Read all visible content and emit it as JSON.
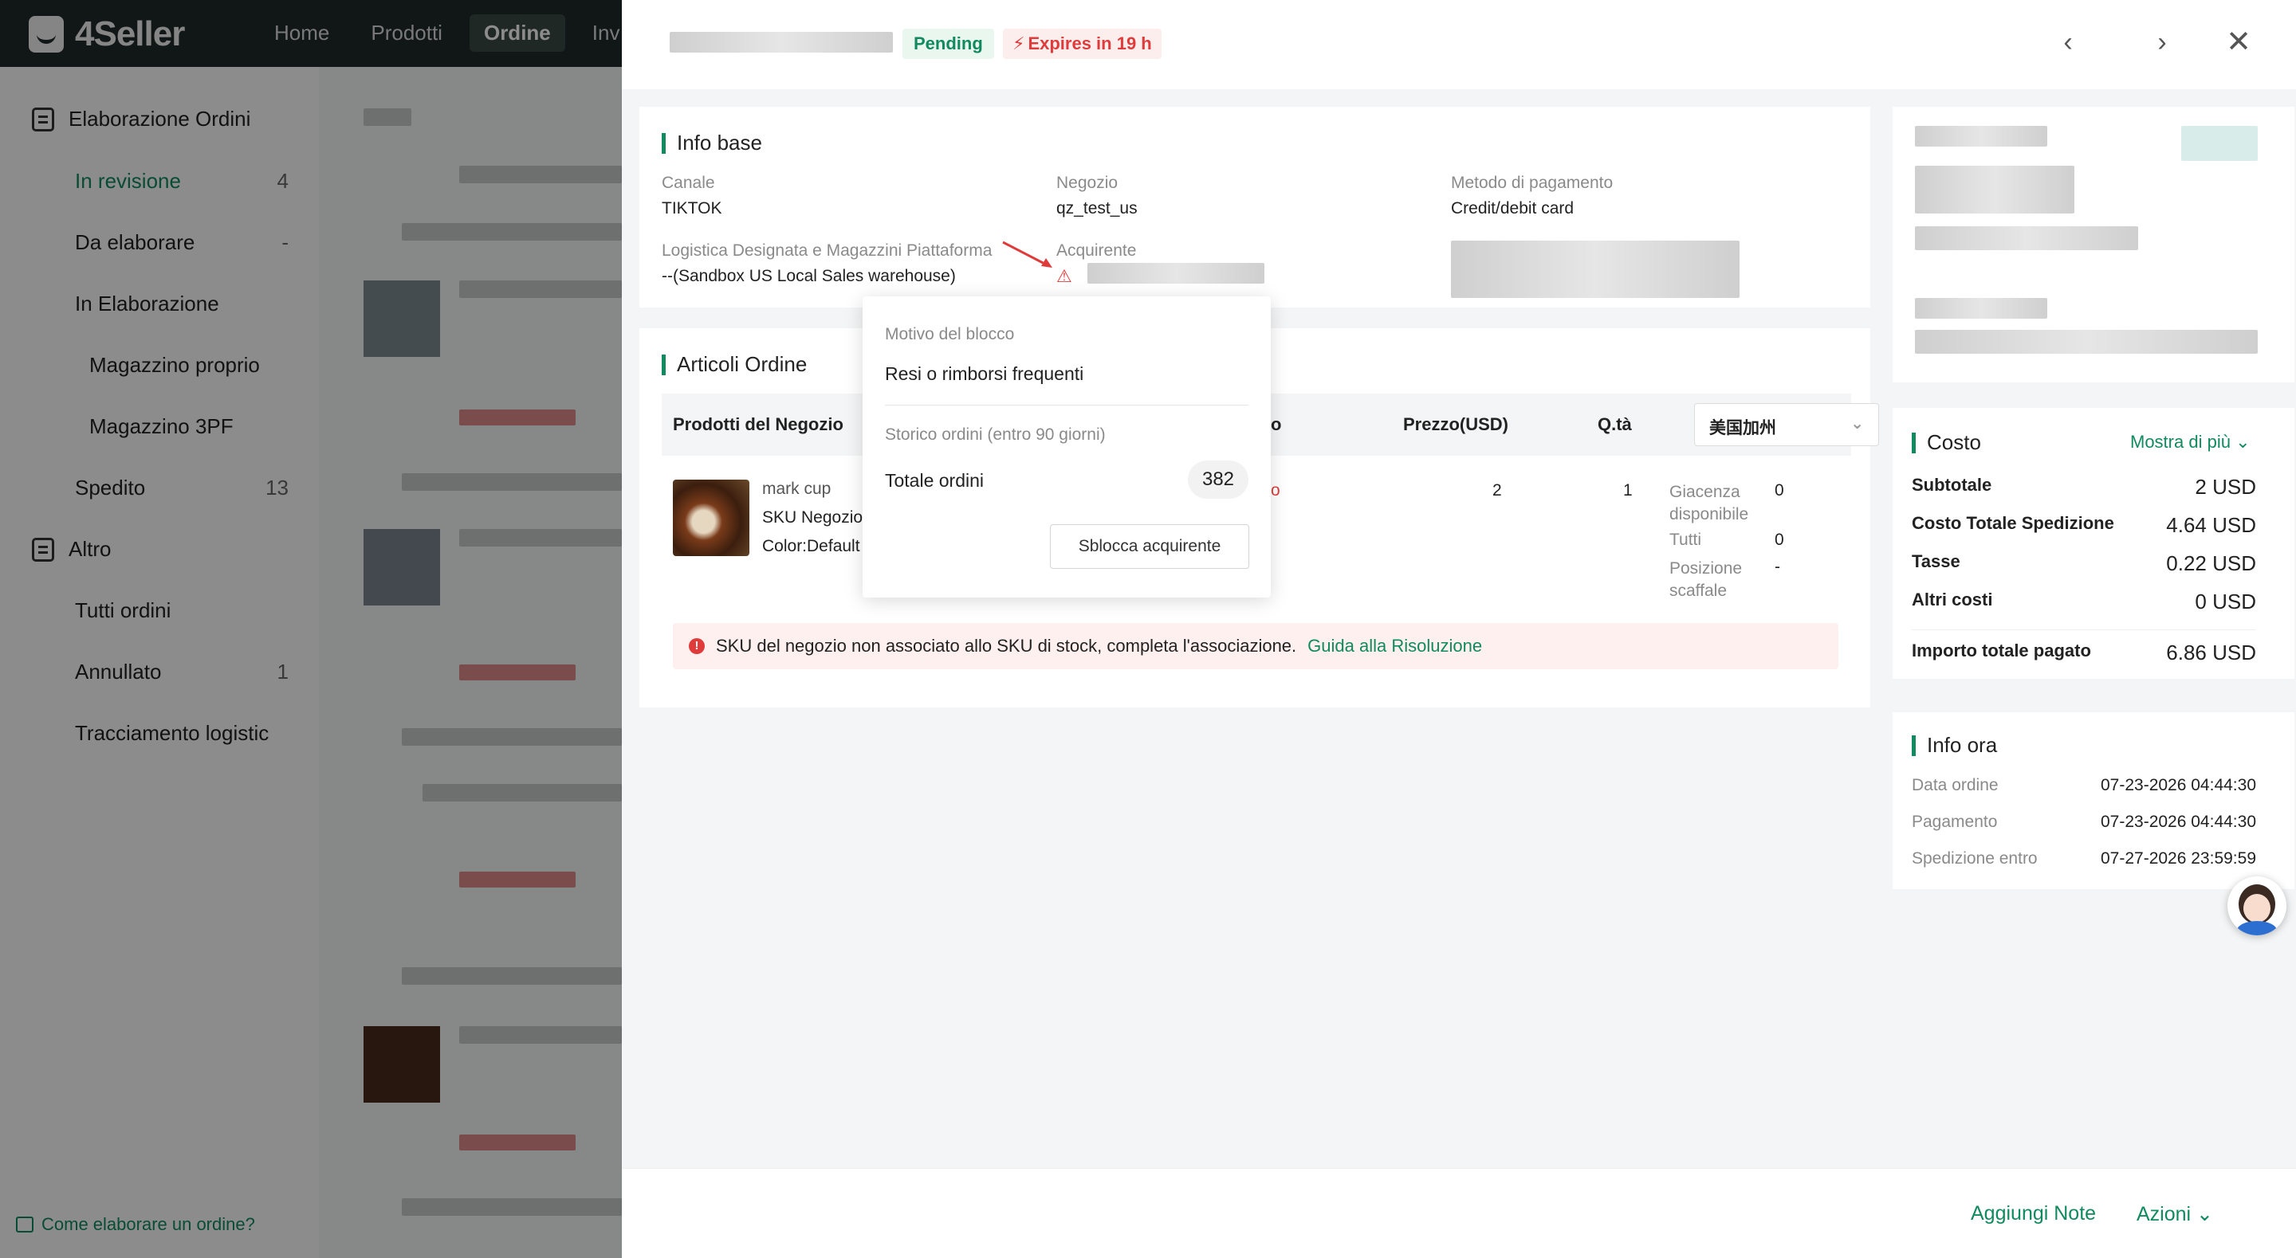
{
  "app": {
    "logo": "4Seller",
    "nav": [
      "Home",
      "Prodotti",
      "Ordine",
      "Inv"
    ],
    "active_nav": "Ordine"
  },
  "sidebar": {
    "group1": "Elaborazione Ordini",
    "items": [
      {
        "label": "In revisione",
        "count": "4"
      },
      {
        "label": "Da elaborare",
        "count": "-"
      },
      {
        "label": "In Elaborazione",
        "count": ""
      },
      {
        "label": "Magazzino proprio",
        "count": ""
      },
      {
        "label": "Magazzino 3PF",
        "count": ""
      },
      {
        "label": "Spedito",
        "count": "13"
      }
    ],
    "group2": "Altro",
    "items2": [
      {
        "label": "Tutti ordini",
        "count": ""
      },
      {
        "label": "Annullato",
        "count": "1"
      },
      {
        "label": "Tracciamento logistic",
        "count": ""
      }
    ],
    "help": "Come elaborare un ordine?"
  },
  "drawer": {
    "status": "Pending",
    "expires": "Expires in 19 h",
    "info_base": {
      "title": "Info base",
      "canale_label": "Canale",
      "canale_value": "TIKTOK",
      "negozio_label": "Negozio",
      "negozio_value": "qz_test_us",
      "pagamento_label": "Metodo di pagamento",
      "pagamento_value": "Credit/debit card",
      "logistica_label": "Logistica Designata e Magazzini Piattaforma",
      "logistica_value": "--(Sandbox US Local Sales warehouse)",
      "acquirente_label": "Acquirente"
    },
    "articoli": {
      "title": "Articoli Ordine",
      "headers": [
        "Prodotti del Negozio",
        "o",
        "Prezzo(USD)",
        "Q.tà"
      ],
      "warehouse": "美国加州",
      "product": {
        "name": "mark cup",
        "sku": "SKU Negozio",
        "color": "Color:Default",
        "price": "2",
        "qty": "1",
        "stock_labels": [
          "Giacenza disponibile",
          "Tutti",
          "Posizione scaffale"
        ],
        "stock_values": [
          "0",
          "0",
          "-"
        ]
      },
      "warning": "SKU del negozio non associato allo SKU di stock, completa l'associazione.",
      "warning_link": "Guida alla Risoluzione"
    },
    "popover": {
      "reason_label": "Motivo del blocco",
      "reason_value": "Resi o rimborsi frequenti",
      "history_label": "Storico ordini (entro 90 giorni)",
      "total_label": "Totale ordini",
      "total_value": "382",
      "unblock_button": "Sblocca acquirente"
    },
    "costo": {
      "title": "Costo",
      "more": "Mostra di più",
      "rows": [
        {
          "label": "Subtotale",
          "value": "2 USD"
        },
        {
          "label": "Costo Totale Spedizione",
          "value": "4.64 USD"
        },
        {
          "label": "Tasse",
          "value": "0.22 USD"
        },
        {
          "label": "Altri costi",
          "value": "0 USD"
        },
        {
          "label": "Importo totale pagato",
          "value": "6.86 USD"
        }
      ]
    },
    "info_ora": {
      "title": "Info ora",
      "rows": [
        {
          "label": "Data ordine",
          "value": "07-23-2026 04:44:30"
        },
        {
          "label": "Pagamento",
          "value": "07-23-2026 04:44:30"
        },
        {
          "label": "Spedizione entro",
          "value": "07-27-2026 23:59:59"
        }
      ]
    },
    "footer": {
      "add_note": "Aggiungi Note",
      "actions": "Azioni"
    }
  },
  "colors": {
    "accent": "#118a5f",
    "danger": "#e03b3b",
    "topbar": "#1f2b28"
  }
}
